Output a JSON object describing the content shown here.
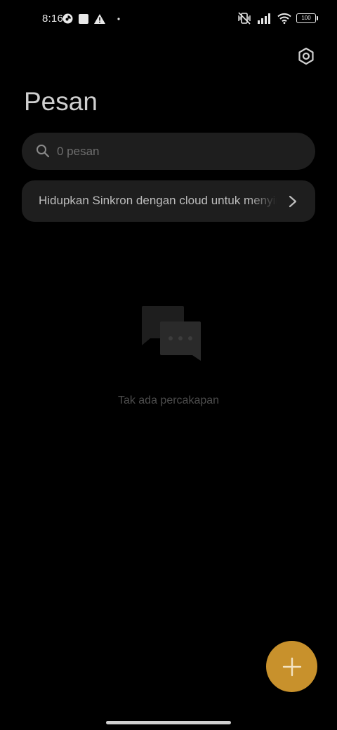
{
  "status_bar": {
    "time": "8:16",
    "battery_level": "100",
    "icons": [
      "data-saver-icon",
      "square-notification-icon",
      "warning-icon",
      "dot-icon",
      "vibrate-off-icon",
      "signal-icon",
      "wifi-icon",
      "battery-icon"
    ]
  },
  "header": {
    "title": "Pesan",
    "settings_icon": "settings-hexagon-icon"
  },
  "search": {
    "placeholder": "0 pesan",
    "value": ""
  },
  "sync_banner": {
    "text": "Hidupkan Sinkron dengan cloud untuk menyinkronkan"
  },
  "empty_state": {
    "icon": "chat-bubbles-icon",
    "text": "Tak ada percakapan"
  },
  "fab": {
    "icon": "plus-icon"
  },
  "colors": {
    "background": "#000000",
    "card": "#1e1e1e",
    "accent": "#c8912c"
  }
}
